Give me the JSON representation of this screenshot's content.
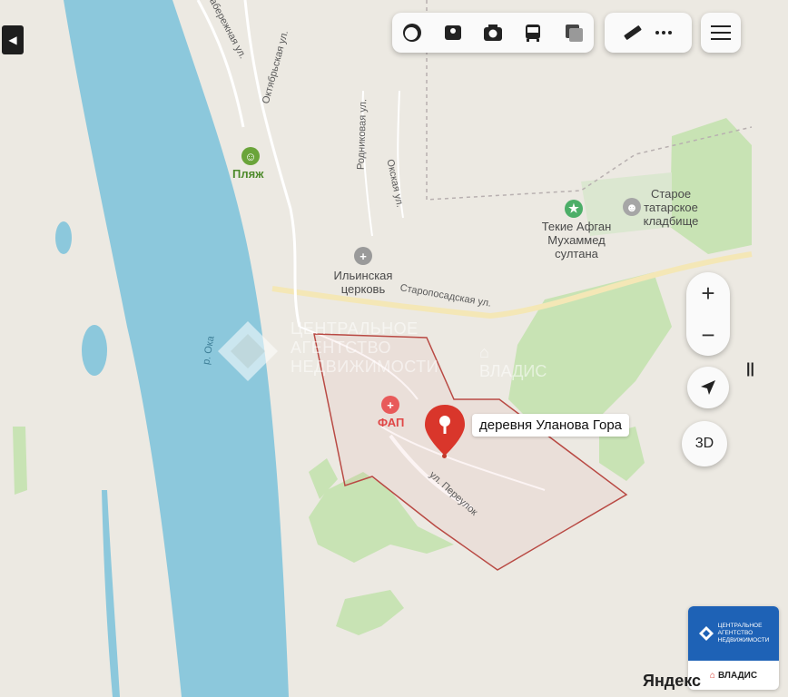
{
  "toolbar": {
    "icons": [
      "layers-icon",
      "panorama-icon",
      "camera-icon",
      "transport-icon",
      "traffic-icon"
    ],
    "ruler_icon": "ruler-icon",
    "more_icon": "more-icon",
    "menu_icon": "menu-icon"
  },
  "controls": {
    "zoom_in": "+",
    "zoom_out": "−",
    "view_3d": "3D",
    "pause": "||"
  },
  "map": {
    "streets": {
      "embankment": "Набережная ул.",
      "oktyabrskaya": "Октябрьская ул.",
      "rodnikovaya": "Родниковая ул.",
      "okskaya": "Окская ул.",
      "staroposadskaya": "Старопосадская ул.",
      "pereulok": "ул. Переулок",
      "river": "р. Ока"
    },
    "pois": {
      "beach": "Пляж",
      "church": "Ильинская\nцерковь",
      "tekie": "Текие Афган\nМухаммед\nсултана",
      "cemetery": "Старое\nтатарское\nкладбище",
      "fap": "ФАП"
    },
    "pin_label": "деревня Уланова Гора"
  },
  "watermark": {
    "line1": "ЦЕНТРАЛЬНОЕ",
    "line2": "АГЕНТСТВО",
    "line3": "НЕДВИЖИМОСТИ",
    "brand": "ВЛАДИС"
  },
  "badge": {
    "line1": "ЦЕНТРАЛЬНОЕ",
    "line2": "АГЕНТСТВО",
    "line3": "НЕДВИЖИМОСТИ",
    "brand": "ВЛАДИС"
  },
  "attribution": "Яндекс",
  "colors": {
    "water": "#8cc8dc",
    "land": "#ece9e2",
    "green": "#c8e3b4",
    "pin": "#d9362b",
    "boundary": "#b94a44",
    "accent_green": "#4cae68",
    "brand_blue": "#1e62b6"
  }
}
